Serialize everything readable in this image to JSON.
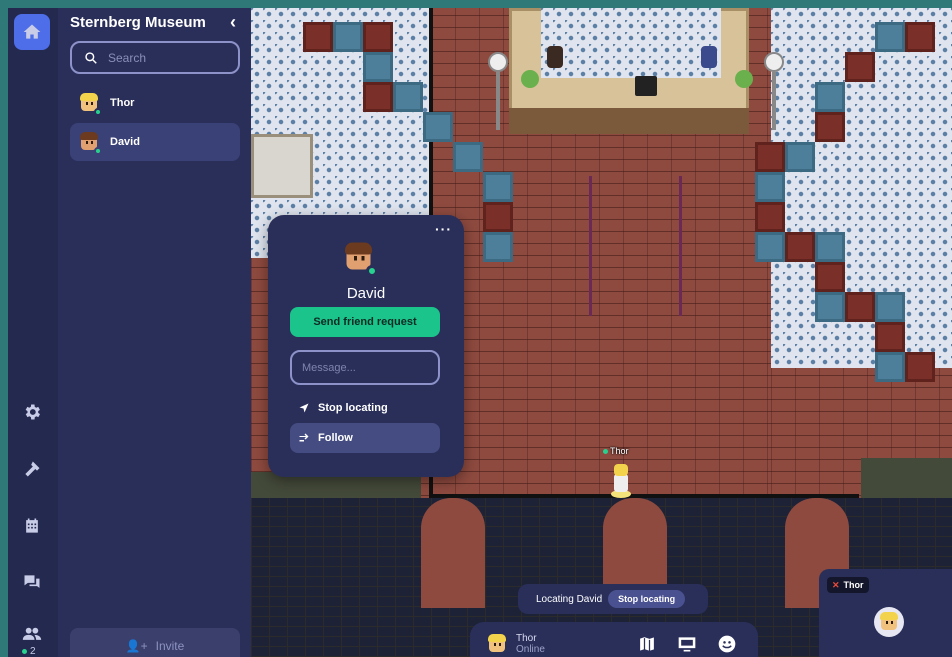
{
  "space": {
    "title": "Sternberg Museum"
  },
  "sidebar": {
    "search_placeholder": "Search",
    "members": [
      {
        "name": "Thor",
        "status": "online",
        "active": false
      },
      {
        "name": "David",
        "status": "online",
        "active": true
      }
    ],
    "invite_label": "Invite"
  },
  "rail": {
    "icons": [
      "home-icon",
      "gear-icon",
      "hammer-icon",
      "calendar-icon",
      "chat-icon",
      "people-icon"
    ],
    "online_count": "2"
  },
  "profile_card": {
    "name": "David",
    "friend_button": "Send friend request",
    "message_placeholder": "Message...",
    "stop_locating": "Stop locating",
    "follow": "Follow"
  },
  "map": {
    "player_tag": "Thor"
  },
  "locating_bar": {
    "text": "Locating David",
    "button": "Stop locating"
  },
  "dock": {
    "user_name": "Thor",
    "user_status": "Online",
    "icons": [
      "map-icon",
      "screen-share-icon",
      "emoji-icon"
    ]
  },
  "video_tile": {
    "name": "Thor"
  },
  "colors": {
    "accent": "#4d6ee8",
    "friend_button": "#1bc48b",
    "online": "#27d28e",
    "panel": "#2a2f5a",
    "frame": "#2f7a78"
  }
}
